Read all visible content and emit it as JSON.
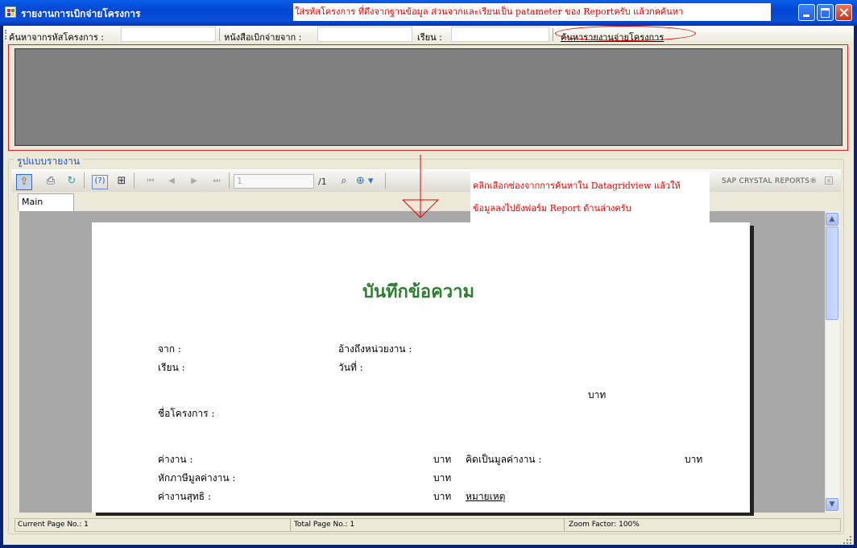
{
  "window": {
    "title": "รายงานการเบิกจ่ายโครงการ",
    "annotation_top": "ใส่รหัสโครงการ ที่ดึงจากฐานข้อมูล ส่วนจากและเรียนเป็น patameter ของ Reportครับ แล้วกดค้นหา"
  },
  "toolbar": {
    "project_code_label": "ค้นหาจากรหัสโครงการ :",
    "project_code_value": "",
    "letter_from_label": "หนังสือเบิกจ่ายจาก :",
    "letter_from_value": "",
    "to_label": "เรียน :",
    "to_value": "",
    "search_button": "ค้นหารายงานจ่ายโครงการ"
  },
  "group": {
    "label": "รูปแบบรายงาน"
  },
  "viewer": {
    "page_input": "1",
    "page_total": "/1",
    "brand": "SAP CRYSTAL REPORTS®",
    "tab": "Main Report",
    "annotation_line1": "คลิกเลือกช่องจากการค้นหาใน Datagridview แล้วให้",
    "annotation_line2": "ข้อมูลลงไปยังฟอร์ม Report ด้านล่างครับ"
  },
  "report": {
    "title": "บันทึกข้อความ",
    "from_label": "จาก :",
    "ref_label": "อ้างถึงหน่วยงาน :",
    "to_label": "เรียน :",
    "date_label": "วันที่ :",
    "baht_1": "บาท",
    "project_name_label": "ชื่อโครงการ :",
    "work_cost_label": "ค่างาน :",
    "baht_2": "บาท",
    "calc_label": "คิดเป็นมูลค่างาน :",
    "baht_3": "บาท",
    "vat_label": "หักภาษีมูลค่างาน :",
    "baht_4": "บาท",
    "net_label": "ค่างานสุทธิ :",
    "baht_5": "บาท",
    "remark_label": "หมายเหตุ"
  },
  "status": {
    "current_page": "Current Page No.: 1",
    "total_page": "Total Page No.: 1",
    "zoom": "Zoom Factor: 100%"
  },
  "colors": {
    "accent": "#0a246a",
    "annotation": "#e00000",
    "report_title": "#2e7d32"
  }
}
